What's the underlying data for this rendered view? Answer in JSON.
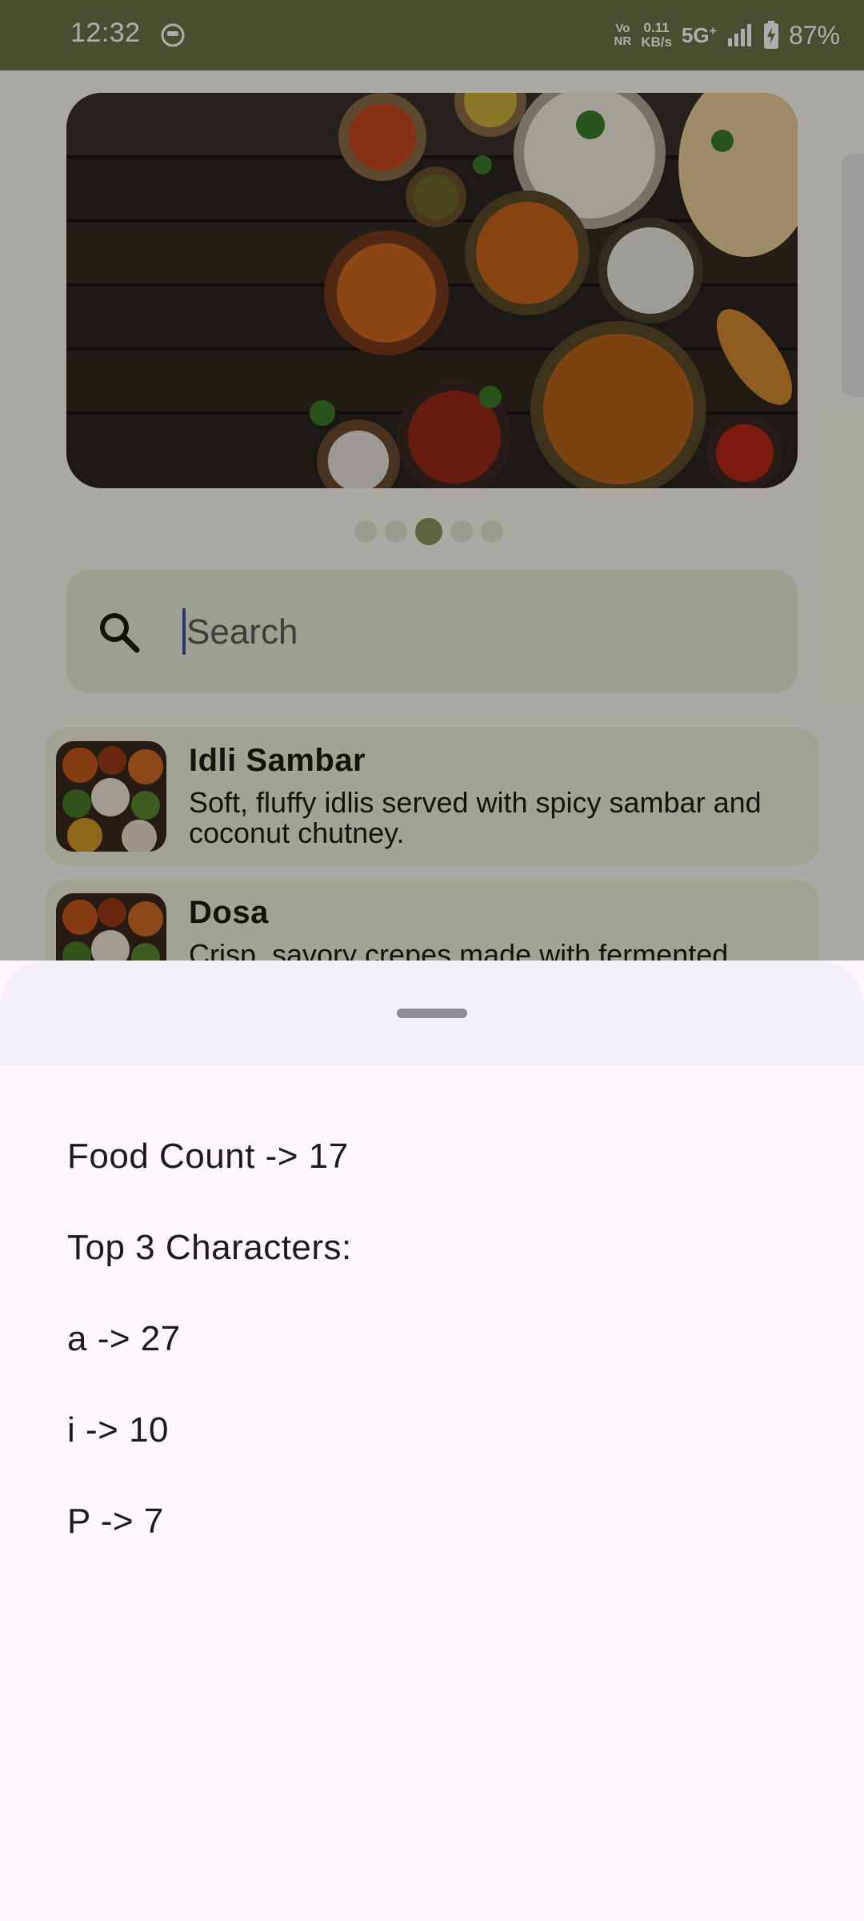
{
  "status_bar": {
    "time": "12:32",
    "volte_top": "Vo",
    "volte_bottom": "NR",
    "speed_value": "0.11",
    "speed_unit": "KB/s",
    "network": "5G",
    "battery_percent": "87%",
    "icons": [
      "app-notification-icon",
      "signal-icon",
      "battery-charging-icon"
    ]
  },
  "banner": {
    "carousel_pages": 5,
    "active_page": 3
  },
  "search": {
    "placeholder": "Search",
    "value": ""
  },
  "foods": [
    {
      "title": "Idli Sambar",
      "description": "Soft, fluffy idlis served with spicy sambar and coconut chutney."
    },
    {
      "title": "Dosa",
      "description": "Crisp, savory crepes made with fermented"
    }
  ],
  "sheet": {
    "food_count": "Food Count -> 17",
    "top_heading": "Top 3 Characters:",
    "top_chars": [
      "a -> 27",
      "i -> 10",
      "P -> 7"
    ]
  },
  "colors": {
    "status_bar": "#6e7348",
    "accent": "#8b9363",
    "card": "#f0f1dc",
    "search_bg": "#e8ead9",
    "sheet": "#fcf8fe"
  }
}
